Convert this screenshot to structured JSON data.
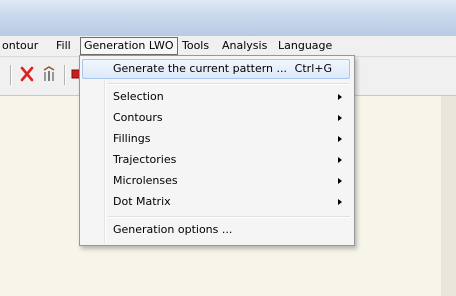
{
  "menubar": {
    "items": [
      {
        "label": "ontour",
        "active": false
      },
      {
        "label": "Fill",
        "active": false
      },
      {
        "label": "Generation LWO",
        "active": true
      },
      {
        "label": "Tools",
        "active": false
      },
      {
        "label": "Analysis",
        "active": false
      },
      {
        "label": "Language",
        "active": false
      }
    ]
  },
  "toolbar": {
    "icons": [
      "delete-icon",
      "shovel-icon",
      "red-square-icon"
    ]
  },
  "dropdown": {
    "items": [
      {
        "label": "Generate the current pattern ...",
        "shortcut": "Ctrl+G",
        "submenu": false,
        "highlighted": true
      },
      {
        "label": "Selection",
        "submenu": true
      },
      {
        "label": "Contours",
        "submenu": true
      },
      {
        "label": "Fillings",
        "submenu": true
      },
      {
        "label": "Trajectories",
        "submenu": true
      },
      {
        "label": "Microlenses",
        "submenu": true
      },
      {
        "label": "Dot Matrix",
        "submenu": true
      },
      {
        "label": "Generation options ...",
        "submenu": false
      }
    ]
  },
  "colors": {
    "titlebar": "#c5d5ea",
    "workspace": "#f7f5e9",
    "delete_red": "#e02020"
  }
}
